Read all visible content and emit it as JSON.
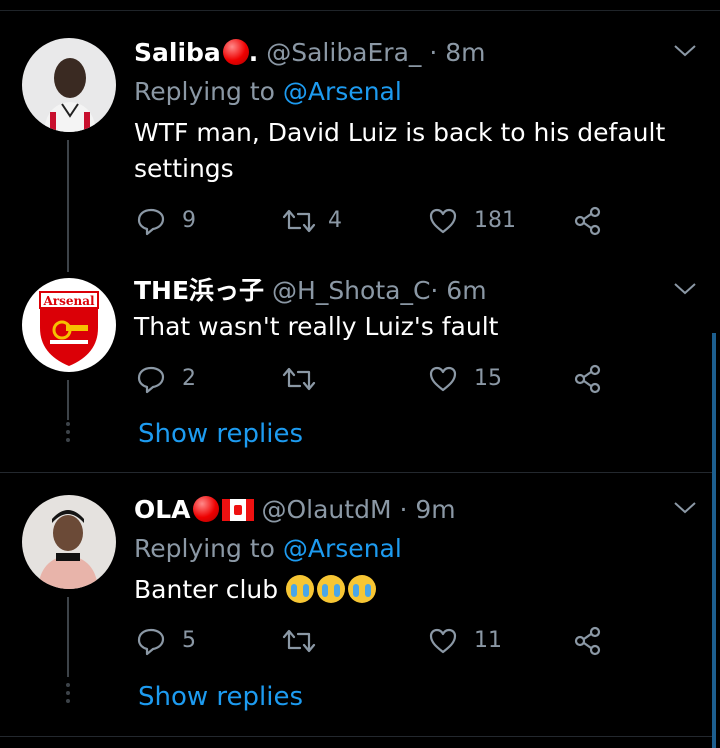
{
  "tweets": [
    {
      "name": "Saliba",
      "name_suffix": ".",
      "handle": "@SalibaEra_",
      "time": "· 8m",
      "replying_prefix": "Replying to",
      "replying_to": "@Arsenal",
      "text": "WTF man, David Luiz is back to his default settings",
      "replies": "9",
      "retweets": "4",
      "likes": "181"
    },
    {
      "name": "THE浜っ子",
      "handle": "@H_Shota_C",
      "time": "· 6m",
      "text": "That wasn't really Luiz's fault",
      "replies": "2",
      "retweets": "",
      "likes": "15",
      "show_replies": "Show replies",
      "avatar_text": "Arsenal"
    },
    {
      "name": "OLA",
      "handle": "@OlautdM",
      "time": "· 9m",
      "replying_prefix": "Replying to",
      "replying_to": "@Arsenal",
      "text": "Banter club",
      "replies": "5",
      "retweets": "",
      "likes": "11",
      "show_replies": "Show replies"
    }
  ],
  "colors": {
    "background": "#000000",
    "secondary_text": "#8b98a5",
    "link": "#1d9bf0",
    "emoji_red": "#e00000"
  },
  "icons": [
    "reply-icon",
    "retweet-icon",
    "like-icon",
    "share-icon",
    "chevron-down-icon"
  ]
}
